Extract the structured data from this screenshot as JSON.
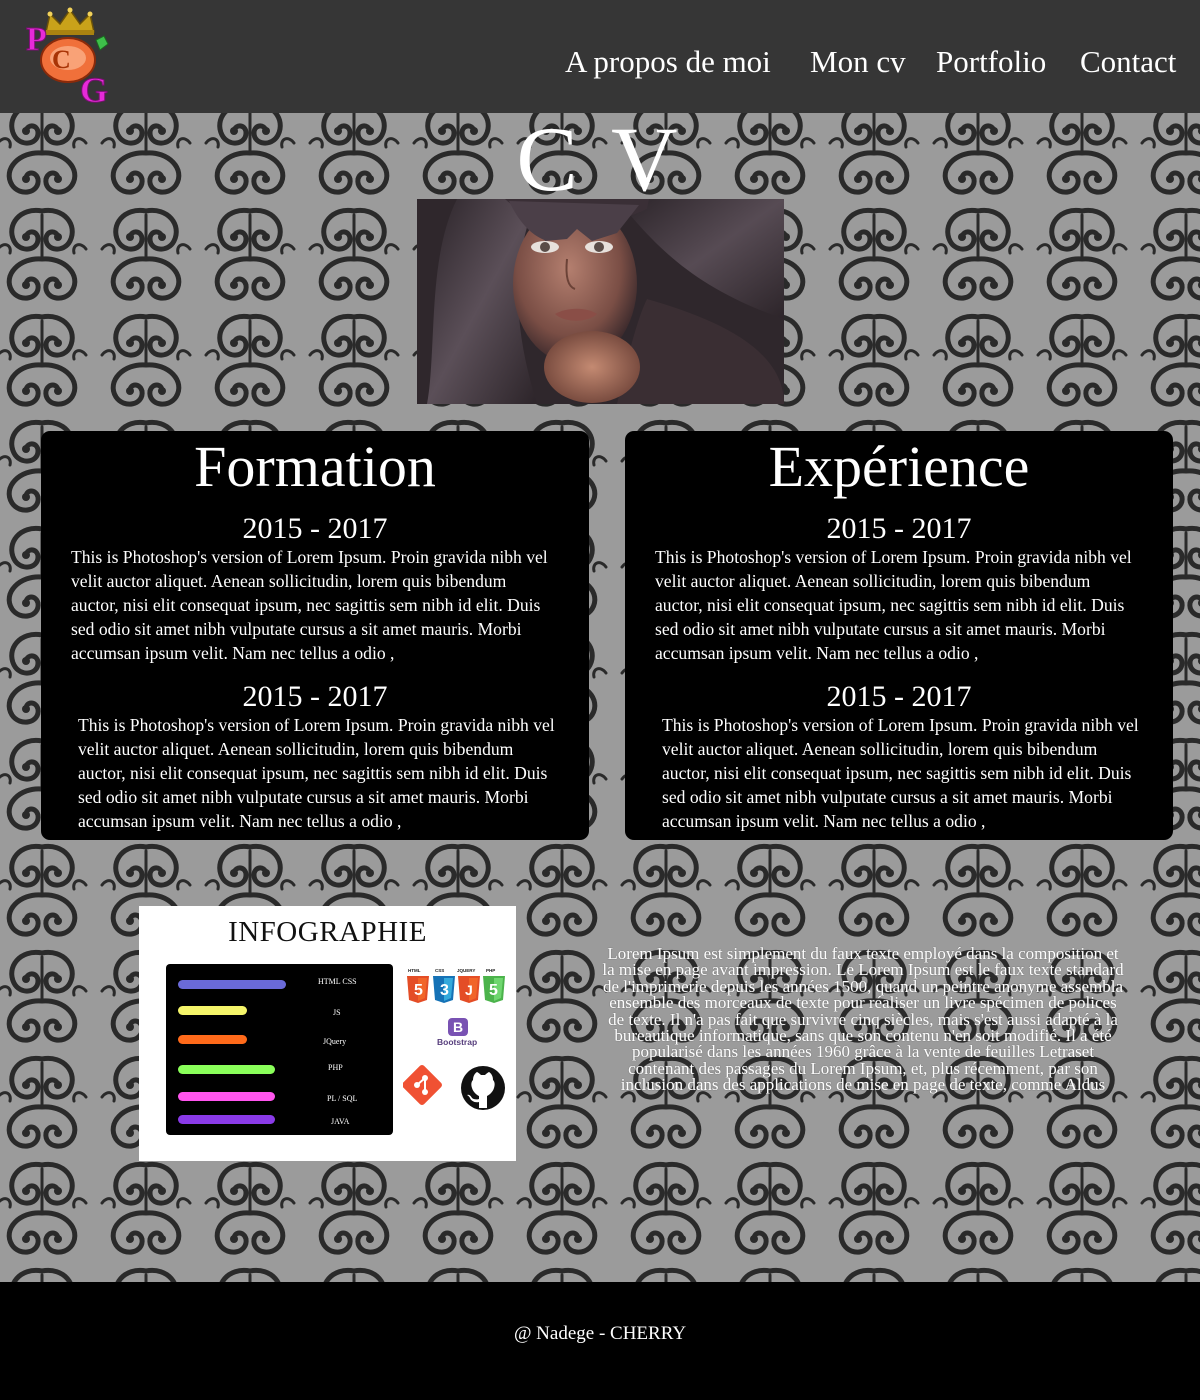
{
  "header": {
    "logo_letters": [
      "P",
      "C",
      "G"
    ],
    "nav": [
      {
        "label": "A propos de moi"
      },
      {
        "label": "Mon cv"
      },
      {
        "label": "Portfolio"
      },
      {
        "label": "Contact"
      }
    ]
  },
  "page_title": "C V",
  "formation": {
    "title": "Formation",
    "entries": [
      {
        "date": "2015 - 2017",
        "lines": [
          "This is Photoshop's version  of Lorem Ipsum. Proin gravida nibh vel",
          "velit auctor aliquet. Aenean sollicitudin, lorem quis bibendum",
          "auctor, nisi elit consequat ipsum, nec sagittis sem nibh id elit. Duis",
          "sed odio sit amet nibh vulputate cursus a sit amet mauris. Morbi",
          "accumsan ipsum velit. Nam nec tellus a odio ,"
        ]
      },
      {
        "date": "2015 - 2017",
        "lines": [
          "This is Photoshop's version  of Lorem Ipsum. Proin gravida nibh vel",
          "velit auctor aliquet. Aenean sollicitudin, lorem quis bibendum",
          "auctor, nisi elit consequat ipsum, nec sagittis sem nibh id elit. Duis",
          "sed odio sit amet nibh vulputate cursus a sit amet mauris. Morbi",
          "accumsan ipsum velit. Nam nec tellus a odio ,"
        ]
      }
    ]
  },
  "experience": {
    "title": "Expérience",
    "entries": [
      {
        "date": "2015 - 2017",
        "lines": [
          "This is Photoshop's version  of Lorem Ipsum. Proin gravida nibh vel",
          "velit auctor aliquet. Aenean sollicitudin, lorem quis bibendum",
          "auctor, nisi elit consequat ipsum, nec sagittis sem nibh id elit. Duis",
          "sed odio sit amet nibh vulputate cursus a sit amet mauris. Morbi",
          "accumsan ipsum velit. Nam nec tellus a odio ,"
        ]
      },
      {
        "date": "2015 - 2017",
        "lines": [
          "This is Photoshop's version  of Lorem Ipsum. Proin gravida nibh vel",
          "velit auctor aliquet. Aenean sollicitudin, lorem quis bibendum",
          "auctor, nisi elit consequat ipsum, nec sagittis sem nibh id elit. Duis",
          "sed odio sit amet nibh vulputate cursus a sit amet mauris. Morbi",
          "accumsan ipsum velit. Nam nec tellus a odio ,"
        ]
      }
    ]
  },
  "infographie": {
    "title": "INFOGRAPHIE",
    "skills": [
      {
        "label": "HTML   CSS",
        "color": "#6a6ad8",
        "level": 0.94
      },
      {
        "label": "JS",
        "color": "#f5f56a",
        "level": 0.6
      },
      {
        "label": "JQuery",
        "color": "#ff6a1a",
        "level": 0.6
      },
      {
        "label": "PHP",
        "color": "#8aff5a",
        "level": 0.84
      },
      {
        "label": "PL / SQL",
        "color": "#ff55ee",
        "level": 0.84
      },
      {
        "label": "JAVA",
        "color": "#8a3ae8",
        "level": 0.84
      }
    ],
    "tech_icons": [
      {
        "name": "html5-icon",
        "label": "HTML"
      },
      {
        "name": "css3-icon",
        "label": "CSS"
      },
      {
        "name": "jquery-icon",
        "label": "JQUERY"
      },
      {
        "name": "php-icon",
        "label": "PHP"
      },
      {
        "name": "bootstrap-icon",
        "label": "Bootstrap",
        "letter": "B"
      },
      {
        "name": "git-icon"
      },
      {
        "name": "github-icon"
      }
    ]
  },
  "lorem": {
    "lines": [
      "Lorem Ipsum est simplement du faux texte employé dans la composition et",
      "la mise en page avant impression. Le Lorem Ipsum est le faux texte standard",
      "de l'imprimerie depuis les années 1500, quand un peintre anonyme assembla",
      "ensemble des morceaux de texte pour réaliser un livre spécimen de polices",
      "de texte. Il n'a pas fait que survivre cinq siècles, mais s'est aussi adapté à la",
      "bureautique informatique, sans que son contenu n'en soit modifié. Il a été",
      "popularisé dans les années 1960 grâce à la vente de feuilles Letraset",
      "contenant des passages du Lorem Ipsum, et, plus récemment, par son",
      "inclusion dans des applications de mise en page de texte, comme Aldus"
    ]
  },
  "footer": {
    "text": "@ Nadege - CHERRY"
  },
  "colors": {
    "header_bg": "#363636",
    "pattern_bg": "#9b9b9b",
    "card_bg": "#000000",
    "footer_bg": "#000000",
    "logo_pink": "#e62ad8"
  }
}
